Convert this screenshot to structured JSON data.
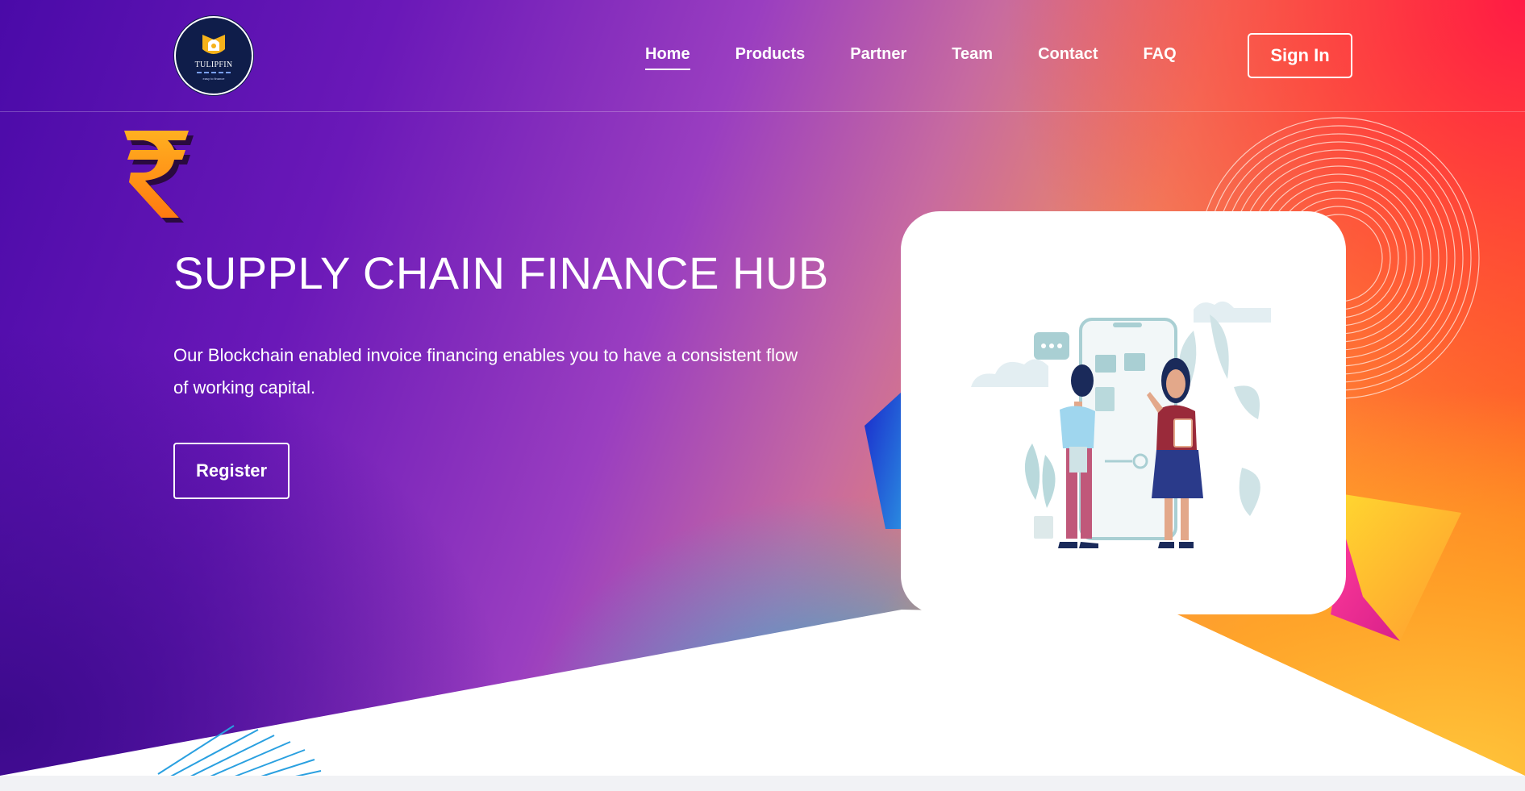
{
  "brand": {
    "logo_text": "TULIPFIN",
    "logo_tagline": "easy to finance"
  },
  "nav": {
    "items": [
      {
        "label": "Home",
        "active": true
      },
      {
        "label": "Products",
        "active": false
      },
      {
        "label": "Partner",
        "active": false
      },
      {
        "label": "Team",
        "active": false
      },
      {
        "label": "Contact",
        "active": false
      },
      {
        "label": "FAQ",
        "active": false
      }
    ],
    "signin_label": "Sign In"
  },
  "hero": {
    "title": "SUPPLY CHAIN FINANCE HUB",
    "description": "Our Blockchain enabled invoice financing enables you to have a consistent flow of working capital.",
    "register_label": "Register",
    "icon": "rupee-icon",
    "illustration": "two-people-with-phone-illustration"
  },
  "colors": {
    "purple": "#4a0aa8",
    "orange": "#ff8a30",
    "red": "#ff1a50",
    "logo_navy": "#0f1d4a"
  }
}
